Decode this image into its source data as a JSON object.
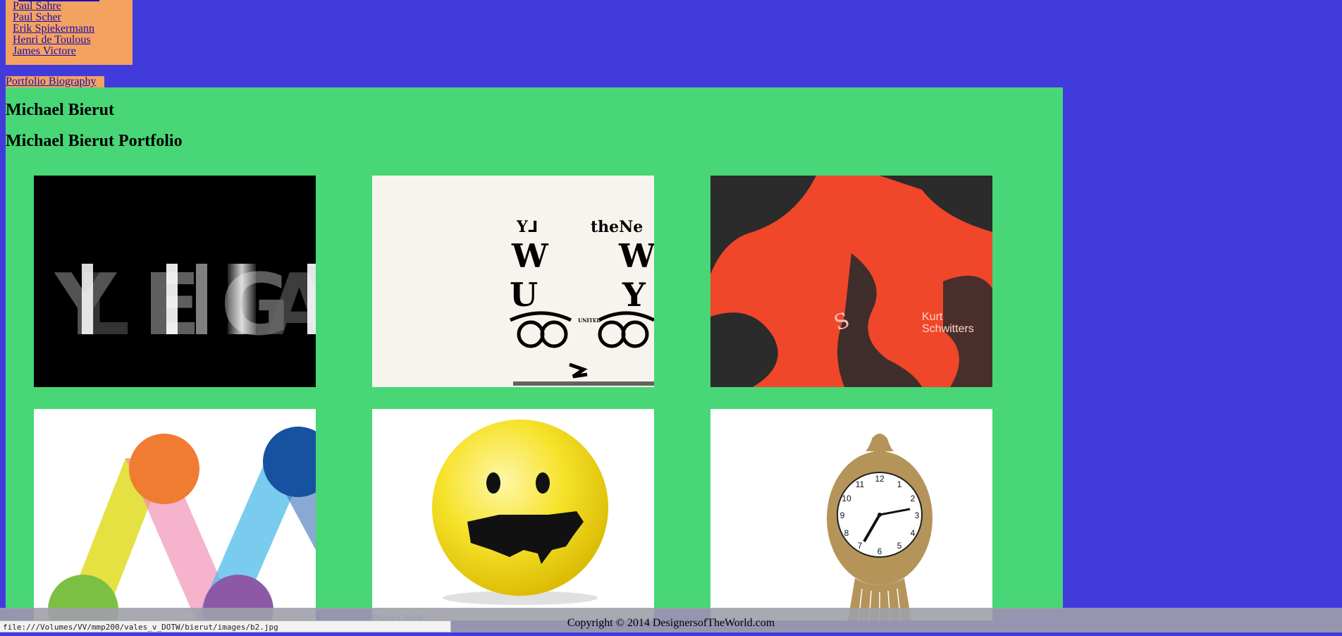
{
  "nav": {
    "designers": [
      "Paul Sahre",
      "Paul Scher",
      "Erik Spiekermann",
      "Henri de Toulous",
      "James Victore"
    ],
    "page_links": "Portfolio Biography"
  },
  "main": {
    "name_heading": "Michael Bierut",
    "portfolio_heading": "Michael Bierut Portfolio",
    "tiles": [
      {
        "label": "YEG"
      },
      {
        "label": "UNITED"
      },
      {
        "label": "Kurt Schwitters"
      },
      {
        "label": "M"
      },
      {
        "label": "smiley-usa"
      },
      {
        "label": "clock"
      }
    ]
  },
  "footer": {
    "copyright": "Copyright © 2014 DesignersofTheWorld.com",
    "ghost_text": "Photo Credit"
  },
  "status_bar": "file:///Volumes/VV/mmp200/vales_v_DOTW/bierut/images/b2.jpg",
  "colors": {
    "page_bg": "#423bdc",
    "menu_bg": "#f4a260",
    "content_bg": "#48d677",
    "red": "#f0462a"
  }
}
